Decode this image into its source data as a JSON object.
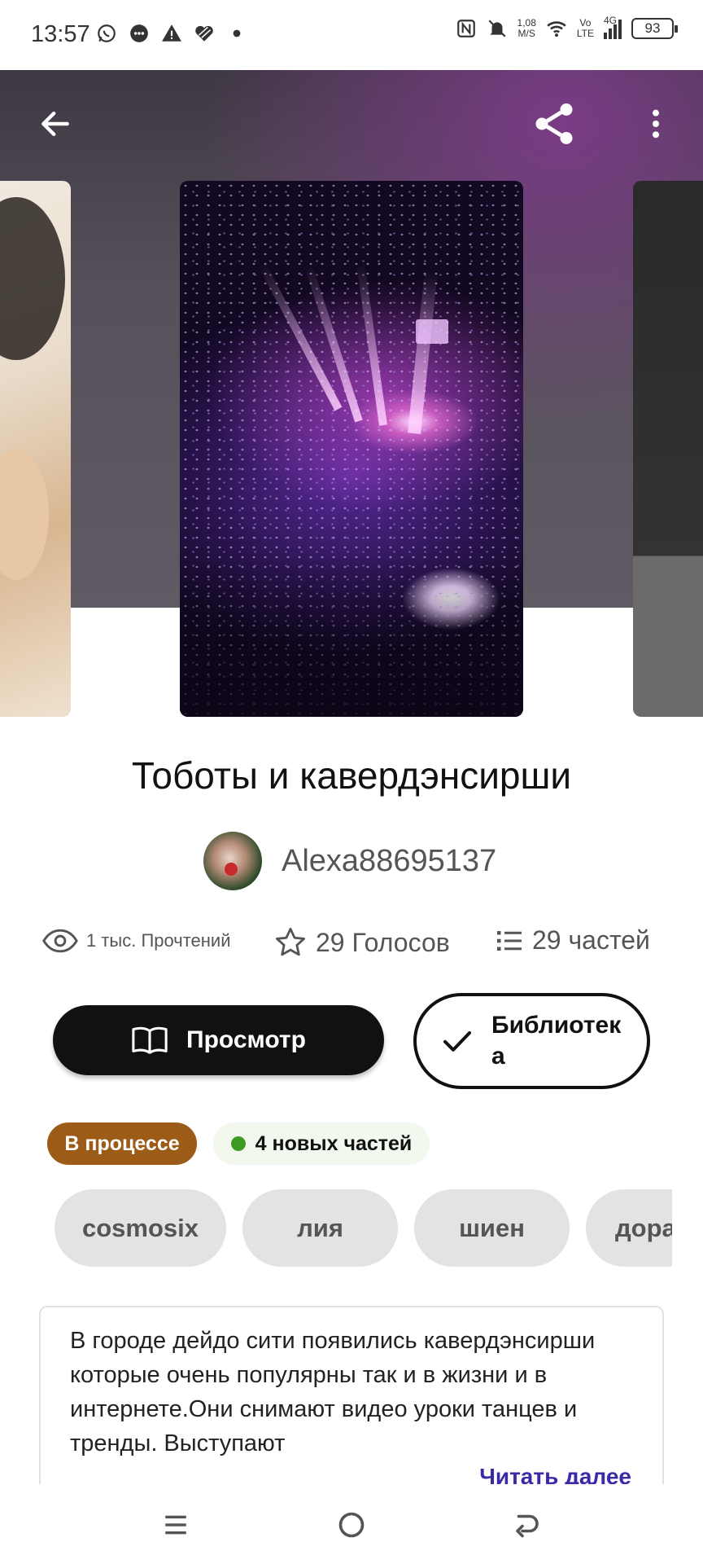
{
  "status_bar": {
    "time": "13:57",
    "network_speed_value": "1,08",
    "network_speed_unit": "M/S",
    "volte_top": "Vo",
    "volte_bottom": "LTE",
    "signal_type": "4G",
    "battery": "93",
    "left_icons": [
      "whatsapp-icon",
      "chat-icon",
      "warning-icon",
      "heart-app-icon",
      "dot-icon"
    ],
    "right_icons": [
      "nfc-icon",
      "mute-icon",
      "wifi-icon",
      "signal-icon",
      "battery-icon"
    ]
  },
  "topbar": {
    "icons": [
      "back-arrow-icon",
      "share-icon",
      "more-vert-icon"
    ]
  },
  "story": {
    "title": "Тоботы и кавердэнсирши",
    "author": "Alexa88695137",
    "stats": {
      "reads": "1 тыс. Прочтений",
      "votes": "29 Голосов",
      "parts": "29 частей"
    },
    "buttons": {
      "view": "Просмотр",
      "library": "Библиотека"
    },
    "status_badge": "В процессе",
    "new_parts_badge": "4 новых частей",
    "tags": [
      "cosmosix",
      "лия",
      "шиен",
      "дора"
    ],
    "description": "В городе дейдо сити появились кавердэнсирши которые очень  популярны так и в жизни и в интернете.Они снимают видео уроки танцев и тренды. Выступают",
    "read_more": "Читать далее"
  },
  "navbar": {
    "icons": [
      "menu-icon",
      "home-circle-icon",
      "back-icon"
    ]
  },
  "colors": {
    "accent_dark": "#111111",
    "badge_progress": "#9c5b16",
    "badge_new_dot": "#3f9a22",
    "read_more": "#3a2aa8",
    "tag_bg": "#e3e2e4"
  }
}
